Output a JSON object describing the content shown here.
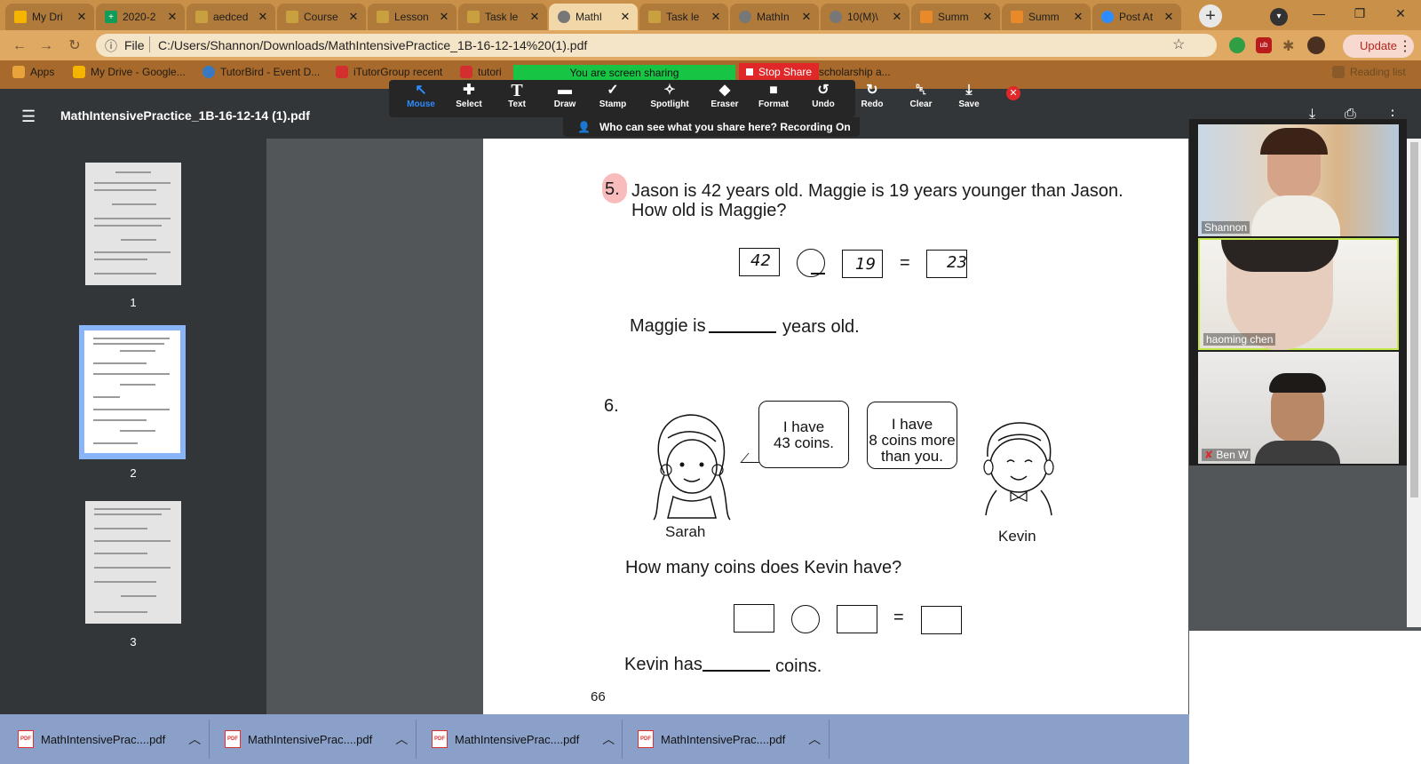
{
  "browser": {
    "tabs": [
      {
        "label": "My Dri",
        "icon": "google-drive-icon",
        "color": "#f4b400"
      },
      {
        "label": "2020-2",
        "icon": "google-sheets-icon",
        "color": "#0f9d58"
      },
      {
        "label": "aedced",
        "icon": "document-icon",
        "color": "#c8a040"
      },
      {
        "label": "Course",
        "icon": "document-icon",
        "color": "#c8a040"
      },
      {
        "label": "Lesson",
        "icon": "document-icon",
        "color": "#c8a040"
      },
      {
        "label": "Task le",
        "icon": "document-icon",
        "color": "#c8a040"
      },
      {
        "label": "MathI",
        "icon": "globe-icon",
        "color": "#777777"
      },
      {
        "label": "Task le",
        "icon": "document-icon",
        "color": "#c8a040"
      },
      {
        "label": "MathIn",
        "icon": "globe-icon",
        "color": "#777777"
      },
      {
        "label": "10(M)\\",
        "icon": "globe-icon",
        "color": "#777777"
      },
      {
        "label": "Summ",
        "icon": "fox-icon",
        "color": "#e88a2a"
      },
      {
        "label": "Summ",
        "icon": "fox-icon",
        "color": "#e88a2a"
      },
      {
        "label": "Post At",
        "icon": "zoom-icon",
        "color": "#2d8cff"
      }
    ],
    "address": {
      "scheme_label": "File",
      "url": "C:/Users/Shannon/Downloads/MathIntensivePractice_1B-16-12-14%20(1).pdf"
    },
    "update_label": "Update",
    "bookmarks": [
      {
        "label": "Apps",
        "color": "#e8a33b"
      },
      {
        "label": "My Drive - Google...",
        "color": "#f4b400"
      },
      {
        "label": "TutorBird - Event D...",
        "color": "#3a78c2"
      },
      {
        "label": "iTutorGroup recent",
        "color": "#d32f2f"
      },
      {
        "label": "tutori",
        "color": "#d32f2f"
      }
    ],
    "bookmark_partial": "scholarship a...",
    "reading_list": "Reading list"
  },
  "zoom": {
    "sharing_banner": "You are screen sharing",
    "stop_share": "Stop Share",
    "tools": [
      {
        "label": "Mouse",
        "glyph": "↖",
        "icon": "mouse-icon"
      },
      {
        "label": "Select",
        "glyph": "✚",
        "icon": "select-icon"
      },
      {
        "label": "Text",
        "glyph": "T",
        "icon": "text-icon"
      },
      {
        "label": "Draw",
        "glyph": "▬",
        "icon": "draw-icon"
      },
      {
        "label": "Stamp",
        "glyph": "✓",
        "icon": "stamp-icon"
      },
      {
        "label": "Spotlight",
        "glyph": "✧",
        "icon": "spotlight-icon"
      },
      {
        "label": "Eraser",
        "glyph": "◆",
        "icon": "eraser-icon"
      },
      {
        "label": "Format",
        "glyph": "■",
        "icon": "format-icon"
      },
      {
        "label": "Undo",
        "glyph": "↺",
        "icon": "undo-icon"
      },
      {
        "label": "Redo",
        "glyph": "↻",
        "icon": "redo-icon"
      },
      {
        "label": "Clear",
        "glyph": "␡",
        "icon": "clear-icon"
      },
      {
        "label": "Save",
        "glyph": "⤓",
        "icon": "save-icon"
      }
    ],
    "who_can_see": "Who can see what you share here? Recording On",
    "participants": [
      {
        "name": "Shannon"
      },
      {
        "name": "haoming   chen"
      },
      {
        "name": "Ben W"
      }
    ]
  },
  "pdf": {
    "title": "MathIntensivePractice_1B-16-12-14 (1).pdf",
    "thumbnails": [
      "1",
      "2",
      "3"
    ],
    "q5": {
      "number": "5.",
      "line1": "Jason is 42 years old. Maggie is 19 years younger than Jason.",
      "line2": "How old is Maggie?",
      "box1": "42",
      "box2": "19",
      "equals": "=",
      "box3": "23",
      "answer_prefix": "Maggie is",
      "answer_suffix": "years old."
    },
    "q6": {
      "number": "6.",
      "sarah_bubble": [
        "I have",
        "43 coins."
      ],
      "kevin_bubble": [
        "I have",
        "8 coins more",
        "than you."
      ],
      "sarah_name": "Sarah",
      "kevin_name": "Kevin",
      "question": "How many coins does Kevin have?",
      "equals": "=",
      "answer_prefix": "Kevin has",
      "answer_suffix": "coins."
    },
    "page_number": "66"
  },
  "downloads": [
    {
      "label": "MathIntensivePrac....pdf"
    },
    {
      "label": "MathIntensivePrac....pdf"
    },
    {
      "label": "MathIntensivePrac....pdf"
    },
    {
      "label": "MathIntensivePrac....pdf"
    }
  ]
}
